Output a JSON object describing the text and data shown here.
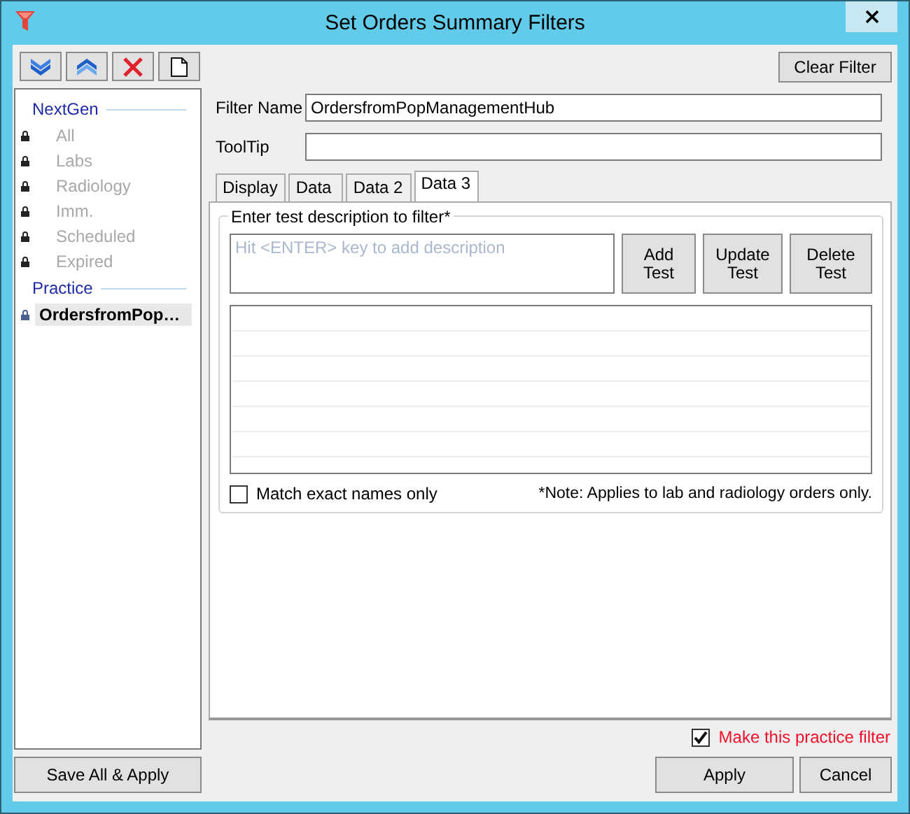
{
  "window": {
    "title": "Set Orders Summary Filters"
  },
  "toolbar": {
    "buttons": [
      {
        "kind": "down"
      },
      {
        "kind": "up"
      },
      {
        "kind": "delete"
      },
      {
        "kind": "new"
      }
    ]
  },
  "filter_groups": [
    {
      "label": "NextGen",
      "items": [
        {
          "label": "All",
          "disabled": true,
          "selected": false
        },
        {
          "label": "Labs",
          "disabled": true,
          "selected": false
        },
        {
          "label": "Radiology",
          "disabled": true,
          "selected": false
        },
        {
          "label": "Imm.",
          "disabled": true,
          "selected": false
        },
        {
          "label": "Scheduled",
          "disabled": true,
          "selected": false
        },
        {
          "label": "Expired",
          "disabled": true,
          "selected": false
        }
      ]
    },
    {
      "label": "Practice",
      "items": [
        {
          "label": "OrdersfromPop…",
          "disabled": false,
          "selected": true
        }
      ]
    }
  ],
  "save_all_button": "Save All & Apply",
  "clear_filter_button": "Clear Filter",
  "fields": [
    {
      "label": "Filter Name",
      "value": "OrdersfromPopManagementHub"
    },
    {
      "label": "ToolTip"
    }
  ],
  "tabs": [
    {
      "label": "Display",
      "selected": false
    },
    {
      "label": "Data",
      "selected": false
    },
    {
      "label": "Data 2",
      "selected": false
    },
    {
      "label": "Data 3",
      "selected": true
    }
  ],
  "test_group": {
    "title": "Enter test description to filter*",
    "placeholder": "Hit <ENTER> key to add description",
    "buttons": [
      {
        "label": "Add\nTest"
      },
      {
        "label": "Update\nTest"
      },
      {
        "label": "Delete\nTest"
      }
    ],
    "match_exact": {
      "label": "Match exact names only",
      "checked": false
    },
    "note": "*Note: Applies to lab and radiology orders only."
  },
  "practice_filter": {
    "label": "Make this practice filter",
    "checked": true
  },
  "buttons": [
    {
      "label": "Apply"
    },
    {
      "label": "Cancel"
    }
  ]
}
